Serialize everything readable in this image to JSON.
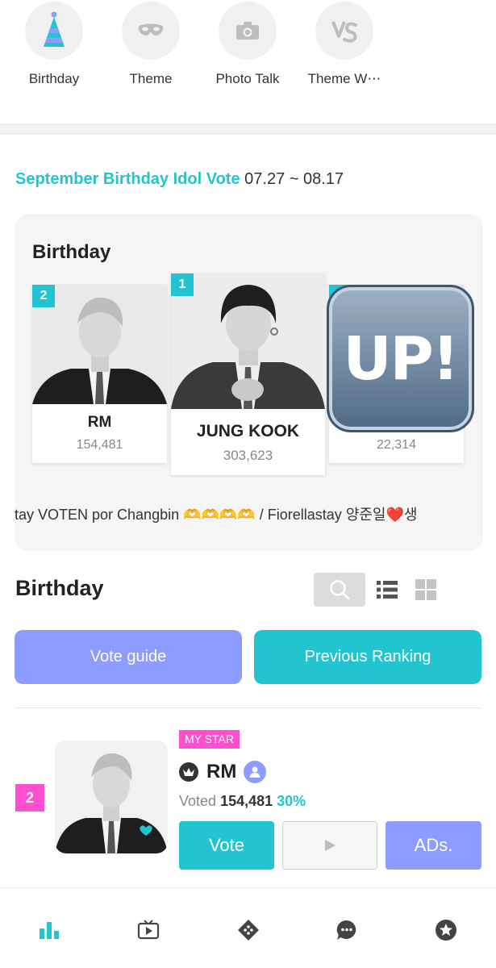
{
  "categories": [
    {
      "label": "Birthday",
      "icon": "party-hat-icon"
    },
    {
      "label": "Theme",
      "icon": "mask-icon"
    },
    {
      "label": "Photo Talk",
      "icon": "camera-icon"
    },
    {
      "label": "Theme W⋯",
      "icon": "vs-icon"
    }
  ],
  "vote": {
    "title": "September Birthday Idol Vote",
    "dates": "07.27 ~ 08.17"
  },
  "podium": {
    "title": "Birthday",
    "entries": [
      {
        "rank": "2",
        "name": "RM",
        "votes": "154,481"
      },
      {
        "rank": "1",
        "name": "JUNG KOOK",
        "votes": "303,623"
      },
      {
        "rank": "3",
        "name": "",
        "votes": "22,314"
      }
    ],
    "up_badge": "UP!",
    "ticker": "tay   VOTEN por Changbin 🫶🫶🫶🫶 / Fiorellastay   양준일❤️생"
  },
  "section": {
    "title": "Birthday",
    "vote_guide_label": "Vote guide",
    "previous_ranking_label": "Previous Ranking"
  },
  "list": [
    {
      "rank": "2",
      "badge": "MY STAR",
      "name": "RM",
      "voted_label": "Voted",
      "votes": "154,481",
      "percent": "30%",
      "vote_label": "Vote",
      "ads_label": "ADs."
    }
  ],
  "colors": {
    "accent_teal": "#22c5cf",
    "accent_periwinkle": "#8c9cff",
    "accent_pink": "#ff4fce"
  },
  "nav": [
    {
      "icon": "ranking-chart-icon",
      "active": true
    },
    {
      "icon": "video-play-icon",
      "active": false
    },
    {
      "icon": "diamond-game-icon",
      "active": false
    },
    {
      "icon": "chat-bubble-icon",
      "active": false
    },
    {
      "icon": "star-badge-icon",
      "active": false
    }
  ]
}
